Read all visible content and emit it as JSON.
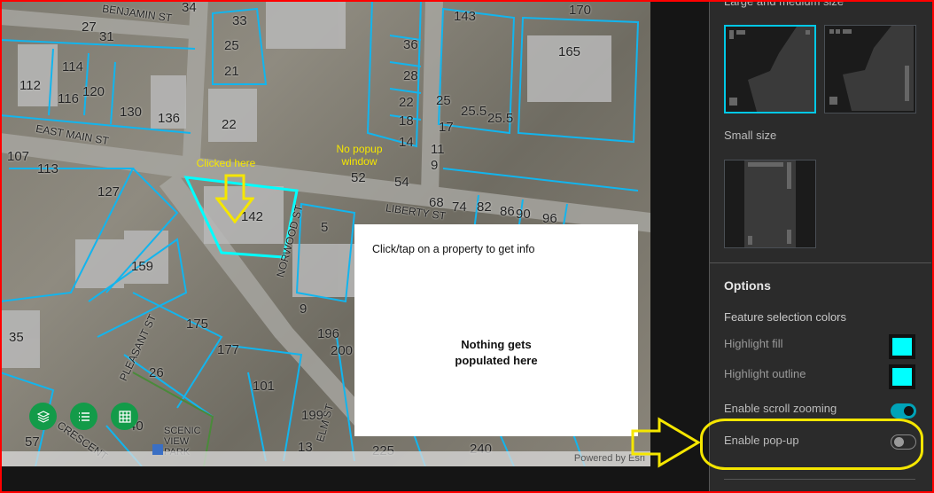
{
  "map": {
    "streets": [
      "BENJAMIN ST",
      "EAST MAIN ST",
      "LIBERTY ST",
      "NORWOOD ST",
      "PLEASANT ST",
      "ELM ST",
      "CRESCENT",
      "SCENIC VIEW PARK"
    ],
    "parcels": [
      "34",
      "27",
      "31",
      "33",
      "143",
      "170",
      "142",
      "114",
      "112",
      "116",
      "120",
      "130",
      "136",
      "25",
      "21",
      "22",
      "36",
      "31",
      "27",
      "28",
      "165",
      "25",
      "25.5",
      "25.5",
      "22",
      "18",
      "14",
      "17",
      "11",
      "9",
      "107",
      "113",
      "127",
      "52",
      "54",
      "68",
      "74",
      "82",
      "86",
      "90",
      "96",
      "142",
      "159",
      "35",
      "175",
      "177",
      "9",
      "196",
      "200",
      "26",
      "101",
      "199",
      "57",
      "40",
      "13",
      "225",
      "240",
      "5"
    ],
    "attribution": "Powered by Esri",
    "buttons": {
      "layers": "layers",
      "legend": "legend",
      "table": "table"
    }
  },
  "annotations": {
    "clicked": "Clicked here",
    "no_popup": "No popup window"
  },
  "popup": {
    "title": "Click/tap on a property to get info",
    "body": "Nothing gets populated here"
  },
  "panel": {
    "large_medium": "Large and medium size",
    "small": "Small size",
    "options": "Options",
    "feature_colors": "Feature selection colors",
    "highlight_fill": "Highlight fill",
    "highlight_outline": "Highlight outline",
    "scroll_zoom": "Enable scroll zooming",
    "popup": "Enable pop-up",
    "scroll_zoom_on": true,
    "popup_on": false,
    "highlight_color": "#00ffff",
    "accent": "#00b3c4"
  }
}
